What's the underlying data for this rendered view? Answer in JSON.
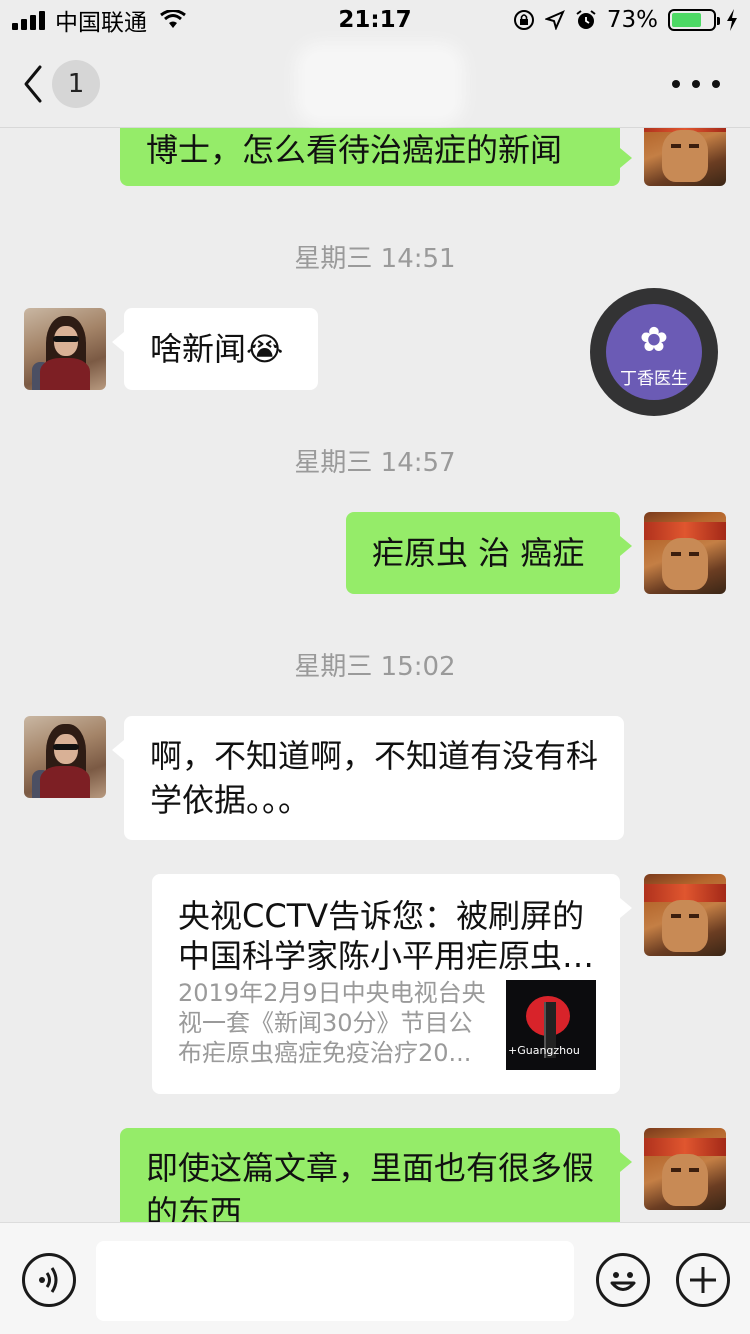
{
  "status_bar": {
    "carrier": "中国联通",
    "time": "21:17",
    "battery_percent": "73%",
    "battery_level": 0.73
  },
  "nav": {
    "unread_count": "1"
  },
  "messages": {
    "m1_text": "博士，怎么看待治癌症的新闻",
    "ts1": "星期三 14:51",
    "m2_text": "啥新闻😭",
    "ts2": "星期三 14:57",
    "m3_text": "疟原虫 治 癌症",
    "ts3": "星期三 15:02",
    "m4_text": "啊，不知道啊，不知道有没有科学依据。。。",
    "link": {
      "title": "央视CCTV告诉您：被刷屏的中国科学家陈小平用疟原虫治疗癌症",
      "desc": "2019年2月9日中央电视台央视一套《新闻30分》节目公布疟原虫癌症免疫治疗20...",
      "thumb_caption": "+Guangzhou"
    },
    "m5_text": "即使这篇文章，里面也有很多假的东西"
  },
  "floating_badge": {
    "label": "丁香医生",
    "color": "#6b5bb5"
  },
  "colors": {
    "sent_bubble": "#95ec69",
    "received_bubble": "#ffffff",
    "background": "#ededed"
  }
}
